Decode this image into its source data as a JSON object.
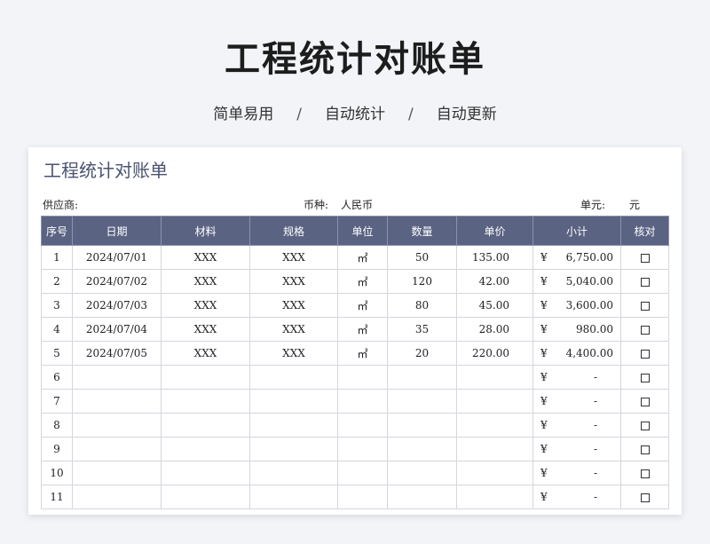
{
  "header": {
    "title": "工程统计对账单",
    "taglines": [
      "简单易用",
      "自动统计",
      "自动更新"
    ],
    "separator": "/"
  },
  "sheet": {
    "title": "工程统计对账单",
    "supplier_label": "供应商:",
    "currency_label": "币种:",
    "currency_value": "人民币",
    "unit_label": "单元:",
    "unit_value": "元"
  },
  "table": {
    "columns": [
      "序号",
      "日期",
      "材料",
      "规格",
      "单位",
      "数量",
      "单价",
      "小计",
      "核对"
    ],
    "currency_symbol": "¥",
    "rows": [
      {
        "no": "1",
        "date": "2024/07/01",
        "material": "XXX",
        "spec": "XXX",
        "unit": "㎡",
        "qty": "50",
        "price": "135.00",
        "subtotal": "6,750.00"
      },
      {
        "no": "2",
        "date": "2024/07/02",
        "material": "XXX",
        "spec": "XXX",
        "unit": "㎡",
        "qty": "120",
        "price": "42.00",
        "subtotal": "5,040.00"
      },
      {
        "no": "3",
        "date": "2024/07/03",
        "material": "XXX",
        "spec": "XXX",
        "unit": "㎡",
        "qty": "80",
        "price": "45.00",
        "subtotal": "3,600.00"
      },
      {
        "no": "4",
        "date": "2024/07/04",
        "material": "XXX",
        "spec": "XXX",
        "unit": "㎡",
        "qty": "35",
        "price": "28.00",
        "subtotal": "980.00"
      },
      {
        "no": "5",
        "date": "2024/07/05",
        "material": "XXX",
        "spec": "XXX",
        "unit": "㎡",
        "qty": "20",
        "price": "220.00",
        "subtotal": "4,400.00"
      },
      {
        "no": "6",
        "date": "",
        "material": "",
        "spec": "",
        "unit": "",
        "qty": "",
        "price": "",
        "subtotal": "-"
      },
      {
        "no": "7",
        "date": "",
        "material": "",
        "spec": "",
        "unit": "",
        "qty": "",
        "price": "",
        "subtotal": "-"
      },
      {
        "no": "8",
        "date": "",
        "material": "",
        "spec": "",
        "unit": "",
        "qty": "",
        "price": "",
        "subtotal": "-"
      },
      {
        "no": "9",
        "date": "",
        "material": "",
        "spec": "",
        "unit": "",
        "qty": "",
        "price": "",
        "subtotal": "-"
      },
      {
        "no": "10",
        "date": "",
        "material": "",
        "spec": "",
        "unit": "",
        "qty": "",
        "price": "",
        "subtotal": "-"
      },
      {
        "no": "11",
        "date": "",
        "material": "",
        "spec": "",
        "unit": "",
        "qty": "",
        "price": "",
        "subtotal": "-"
      }
    ]
  }
}
